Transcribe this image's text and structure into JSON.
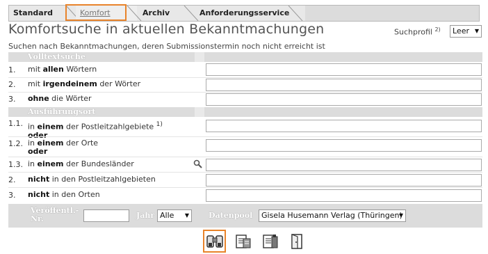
{
  "tabs": [
    {
      "label": "Standard",
      "active": false
    },
    {
      "label": "Komfort",
      "active": true
    },
    {
      "label": "Archiv",
      "active": false
    },
    {
      "label": "Anforderungsservice",
      "active": false
    }
  ],
  "header": {
    "title": "Komfortsuche in aktuellen Bekanntmachungen",
    "suchprofil_label": "Suchprofil",
    "suchprofil_sup": "2)",
    "suchprofil_value": "Leer"
  },
  "subtitle": "Suchen nach Bekanntmachungen, deren Submissionstermin noch nicht erreicht ist",
  "sections": {
    "volltext": "Volltextsuche",
    "ort": "Ausführungsort"
  },
  "volltext_rows": [
    {
      "num": "1.",
      "pre": "mit ",
      "bold": "allen",
      "post": " Wörtern"
    },
    {
      "num": "2.",
      "pre": "mit ",
      "bold": "irgendeinem",
      "post": " der Wörter"
    },
    {
      "num": "3.",
      "pre": "",
      "bold": "ohne",
      "post": " die Wörter"
    }
  ],
  "ort_rows": [
    {
      "num": "1.1.",
      "pre": "in ",
      "bold": "einem",
      "post": " der Postleitzahlgebiete",
      "sup": "1)",
      "extra": "oder"
    },
    {
      "num": "1.2.",
      "pre": "in ",
      "bold": "einem",
      "post": " der Orte",
      "extra": "oder"
    },
    {
      "num": "1.3.",
      "pre": "in ",
      "bold": "einem",
      "post": " der Bundesländer"
    },
    {
      "num": "2.",
      "pre": "",
      "bold": "nicht",
      "post": " in den Postleitzahlgebieten"
    },
    {
      "num": "3.",
      "pre": "",
      "bold": "nicht",
      "post": " in den Orten"
    }
  ],
  "bottom": {
    "veroeff_label": "Veröffentl.-Nr.",
    "jahr_label": "Jahr",
    "jahr_value": "Alle",
    "datenpool_label": "Datenpool",
    "datenpool_value": "Gisela Husemann Verlag (Thüringen)"
  },
  "buttons": [
    "binoculars-icon",
    "export-list-icon",
    "export-doc-icon",
    "exit-door-icon"
  ]
}
